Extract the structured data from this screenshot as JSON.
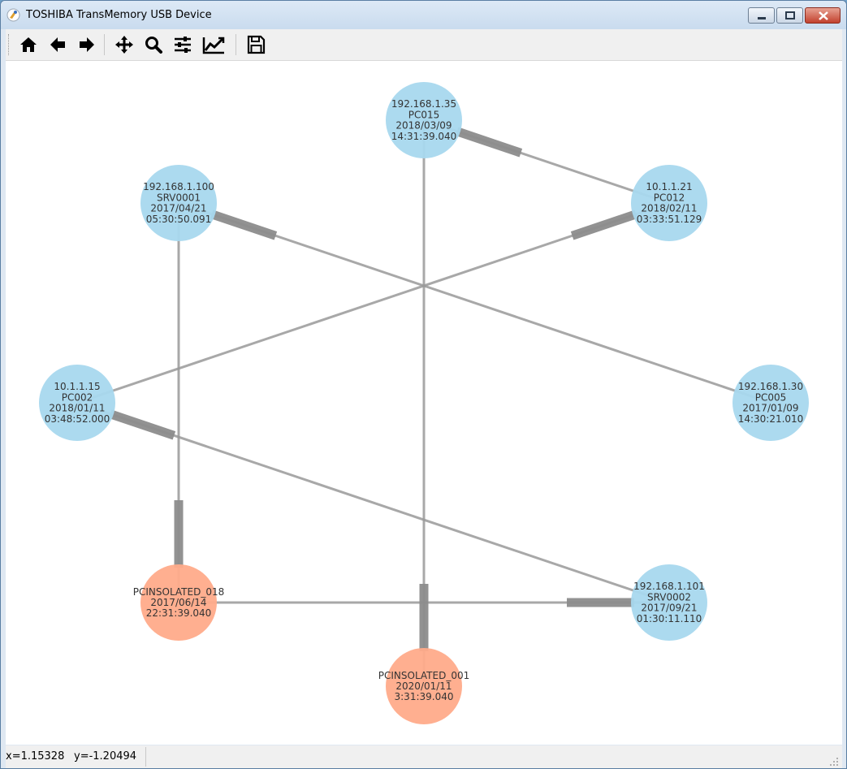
{
  "window": {
    "title": "TOSHIBA TransMemory USB Device"
  },
  "toolbar": {
    "buttons": [
      {
        "id": "home",
        "icon": "home-icon"
      },
      {
        "id": "back",
        "icon": "arrow-left-icon"
      },
      {
        "id": "forward",
        "icon": "arrow-right-icon"
      },
      {
        "id": "pan",
        "icon": "move-icon"
      },
      {
        "id": "zoom",
        "icon": "magnifier-icon"
      },
      {
        "id": "subplots",
        "icon": "sliders-icon"
      },
      {
        "id": "edit-axis",
        "icon": "chart-line-icon"
      },
      {
        "id": "save",
        "icon": "floppy-disk-icon"
      }
    ]
  },
  "status": {
    "x_readout": "x=1.15328",
    "y_readout": "y=-1.20494"
  },
  "colors": {
    "node_blue": "#a8d8ee",
    "node_orange": "#ffab8a",
    "edge": "#999999",
    "label": "#333333"
  },
  "graph": {
    "nodes": [
      {
        "id": "pc015",
        "lines": [
          "192.168.1.35",
          "PC015",
          "2018/03/09",
          "14:31:39.040"
        ],
        "color": "blue"
      },
      {
        "id": "pc012",
        "lines": [
          "10.1.1.21",
          "PC012",
          "2018/02/11",
          "03:33:51.129"
        ],
        "color": "blue"
      },
      {
        "id": "pc005",
        "lines": [
          "192.168.1.30",
          "PC005",
          "2017/01/09",
          "14:30:21.010"
        ],
        "color": "blue"
      },
      {
        "id": "srv0002",
        "lines": [
          "192.168.1.101",
          "SRV0002",
          "2017/09/21",
          "01:30:11.110"
        ],
        "color": "blue"
      },
      {
        "id": "pcisolated_001",
        "lines": [
          "PCINSOLATED_001",
          "2020/01/11",
          "3:31:39.040"
        ],
        "color": "orange"
      },
      {
        "id": "pcisolated_018",
        "lines": [
          "PCINSOLATED_018",
          "2017/06/14",
          "22:31:39.040"
        ],
        "color": "orange"
      },
      {
        "id": "pc002",
        "lines": [
          "10.1.1.15",
          "PC002",
          "2018/01/11",
          "03:48:52.000"
        ],
        "color": "blue"
      },
      {
        "id": "srv0001",
        "lines": [
          "192.168.1.100",
          "SRV0001",
          "2017/04/21",
          "05:30:50.091"
        ],
        "color": "blue"
      }
    ],
    "edges": [
      {
        "source": "pc012",
        "target": "pc015"
      },
      {
        "source": "pc005",
        "target": "srv0001"
      },
      {
        "source": "pc002",
        "target": "pc012"
      },
      {
        "source": "srv0002",
        "target": "pc002"
      },
      {
        "source": "pcisolated_018",
        "target": "srv0002"
      },
      {
        "source": "pc015",
        "target": "pcisolated_001"
      },
      {
        "source": "srv0001",
        "target": "pcisolated_018"
      }
    ]
  }
}
